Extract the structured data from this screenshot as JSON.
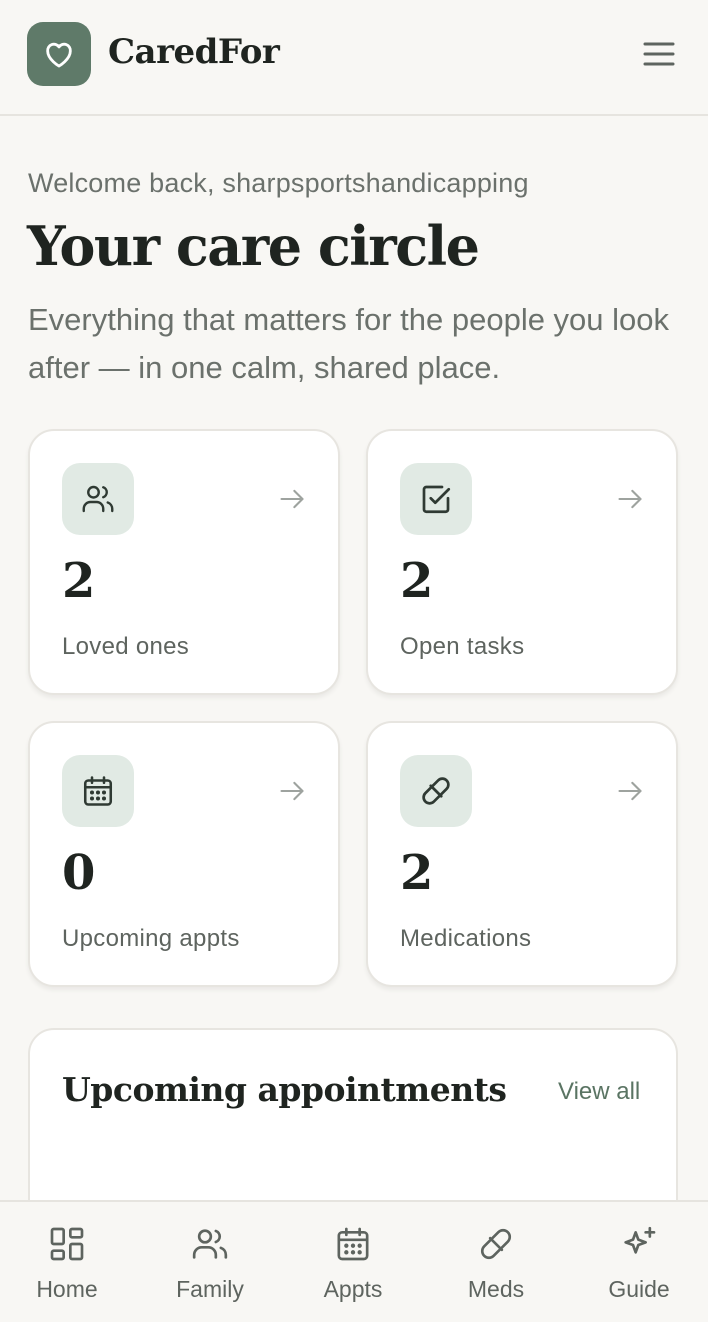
{
  "header": {
    "brand": "CaredFor",
    "logo_icon": "heart-icon",
    "menu_icon": "hamburger-menu-icon"
  },
  "hero": {
    "welcome": "Welcome back, sharpsportshandicapping",
    "title": "Your care circle",
    "subtitle": "Everything that matters for the people you look after — in one calm, shared place."
  },
  "stats": [
    {
      "icon": "users-icon",
      "value": "2",
      "label": "Loved ones"
    },
    {
      "icon": "checkbox-icon",
      "value": "2",
      "label": "Open tasks"
    },
    {
      "icon": "calendar-icon",
      "value": "0",
      "label": "Upcoming appts"
    },
    {
      "icon": "pill-icon",
      "value": "2",
      "label": "Medications"
    }
  ],
  "appointments": {
    "title": "Upcoming appointments",
    "view_all": "View all"
  },
  "nav": [
    {
      "icon": "grid-icon",
      "label": "Home"
    },
    {
      "icon": "users-icon",
      "label": "Family"
    },
    {
      "icon": "calendar-icon",
      "label": "Appts"
    },
    {
      "icon": "pill-icon",
      "label": "Meds"
    },
    {
      "icon": "sparkle-icon",
      "label": "Guide"
    }
  ],
  "colors": {
    "background": "#f8f7f4",
    "brand_green": "#5f7a69",
    "icon_tile": "#e1eae4",
    "text_dark": "#1f2420",
    "text_muted": "#6b716c"
  }
}
